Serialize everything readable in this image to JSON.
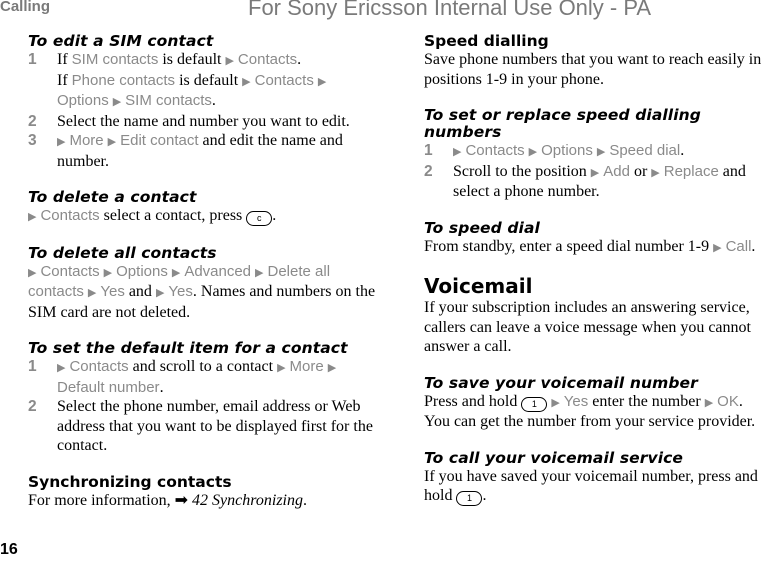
{
  "header": {
    "section": "Calling",
    "watermark": "For Sony Ericsson Internal Use Only - PA"
  },
  "page_number": "16",
  "left_column": {
    "edit_sim": {
      "title": "To edit a SIM contact",
      "steps": [
        {
          "num": "1",
          "line1_a": "If ",
          "line1_ui1": "SIM contacts",
          "line1_b": " is default ",
          "line1_ui2": "Contacts",
          "line1_c": ".",
          "line2_a": "If ",
          "line2_ui1": "Phone contacts",
          "line2_b": " is default ",
          "line2_ui2": "Contacts",
          "line3_ui1": "Options",
          "line3_ui2": "SIM contacts",
          "line3_c": "."
        },
        {
          "num": "2",
          "text": "Select the name and number you want to edit."
        },
        {
          "num": "3",
          "ui1": "More",
          "ui2": "Edit contact",
          "text": " and edit the name and number."
        }
      ]
    },
    "delete_contact": {
      "title": "To delete a contact",
      "ui1": "Contacts",
      "text": " select a contact, press ",
      "key": "c",
      "end": "."
    },
    "delete_all": {
      "title": "To delete all contacts",
      "ui": [
        "Contacts",
        "Options",
        "Advanced",
        "Delete all contacts",
        "Yes",
        "Yes"
      ],
      "and": " and ",
      "text": ". Names and numbers on the SIM card are not deleted."
    },
    "default_item": {
      "title": "To set the default item for a contact",
      "steps": [
        {
          "num": "1",
          "ui1": "Contacts",
          "text": " and scroll to a contact ",
          "ui2": "More",
          "ui3": "Default number",
          "end": "."
        },
        {
          "num": "2",
          "text": "Select the phone number, email address or Web address that you want to be displayed first for the contact."
        }
      ]
    },
    "sync": {
      "title": "Synchronizing contacts",
      "text": "For more information, ",
      "ref": "42 Synchronizing",
      "end": "."
    }
  },
  "right_column": {
    "speed_dialling": {
      "title": "Speed dialling",
      "text": "Save phone numbers that you want to reach easily in positions 1-9 in your phone."
    },
    "set_speed": {
      "title": "To set or replace speed dialling numbers",
      "steps": [
        {
          "num": "1",
          "ui": [
            "Contacts",
            "Options",
            "Speed dial"
          ],
          "end": "."
        },
        {
          "num": "2",
          "text_a": "Scroll to the position ",
          "ui1": "Add",
          "or": " or ",
          "ui2": "Replace",
          "text_b": " and select a phone number."
        }
      ]
    },
    "speed_dial": {
      "title": "To speed dial",
      "text": "From standby, enter a speed dial number 1-9 ",
      "ui": "Call",
      "end": "."
    },
    "voicemail": {
      "title": "Voicemail",
      "text": "If your subscription includes an answering service, callers can leave a voice message when you cannot answer a call."
    },
    "save_voicemail": {
      "title": "To save your voicemail number",
      "text_a": "Press and hold ",
      "key": "1",
      "ui1": "Yes",
      "text_b": " enter the number ",
      "ui2": "OK",
      "text_c": ". You can get the number from your service provider."
    },
    "call_voicemail": {
      "title": "To call your voicemail service",
      "text": "If you have saved your voicemail number, press and hold ",
      "key": "1",
      "end": "."
    }
  },
  "icons": {
    "menu_arrow": "▶",
    "ref_arrow": "➡"
  }
}
